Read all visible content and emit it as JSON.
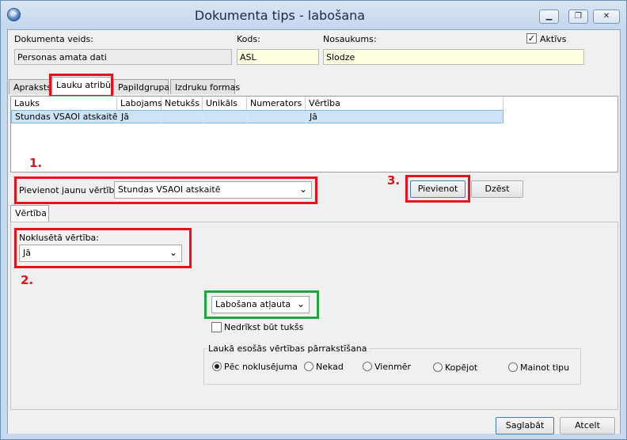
{
  "window": {
    "title": "Dokumenta tips - labošana",
    "minimize_glyph": "▁",
    "restore_glyph": "❐",
    "close_glyph": "✕"
  },
  "header": {
    "doc_type_label": "Dokumenta veids:",
    "doc_type_value": "Personas amata dati",
    "code_label": "Kods:",
    "code_value": "ASL",
    "name_label": "Nosaukums:",
    "name_value": "Slodze",
    "active_label": "Aktīvs",
    "active_checked": "✓"
  },
  "tabs": [
    "Apraksts",
    "Lauku atribūti",
    "Papildgrupas",
    "Izdruku formas"
  ],
  "grid": {
    "columns": [
      "Lauks",
      "Labojams",
      "Netukšs",
      "Unikāls",
      "Numerators",
      "Vērtība"
    ],
    "rows": [
      [
        "Stundas VSAOI atskaitē",
        "Jā",
        "",
        "",
        "",
        "Jā"
      ]
    ]
  },
  "add_value": {
    "label": "Pievienot jaunu vērtību:",
    "selected": "Stundas VSAOI atskaitē",
    "add_button": "Pievienot",
    "delete_button": "Dzēst"
  },
  "value_tab": "Vērtība",
  "default_value": {
    "label": "Noklusētā vērtība:",
    "selected": "Jā"
  },
  "edit_mode": {
    "selected": "Labošana atļauta",
    "not_empty_label": "Nedrīkst būt tukšs"
  },
  "overwrite_group": {
    "title": "Laukā esošās vērtības pārrakstīšana",
    "options": [
      "Pēc noklusējuma",
      "Nekad",
      "Vienmēr",
      "Kopējot",
      "Mainot tipu"
    ],
    "selected_index": 0
  },
  "footer": {
    "save_button": "Saglabāt",
    "cancel_button": "Atcelt"
  },
  "annotations": {
    "n1": "1.",
    "n2": "2.",
    "n3": "3."
  },
  "colors": {
    "annotation_red": "#e8111b",
    "annotation_green": "#1fa83a",
    "selected_row": "#cce4f7",
    "input_yellow": "#ffffe1"
  }
}
